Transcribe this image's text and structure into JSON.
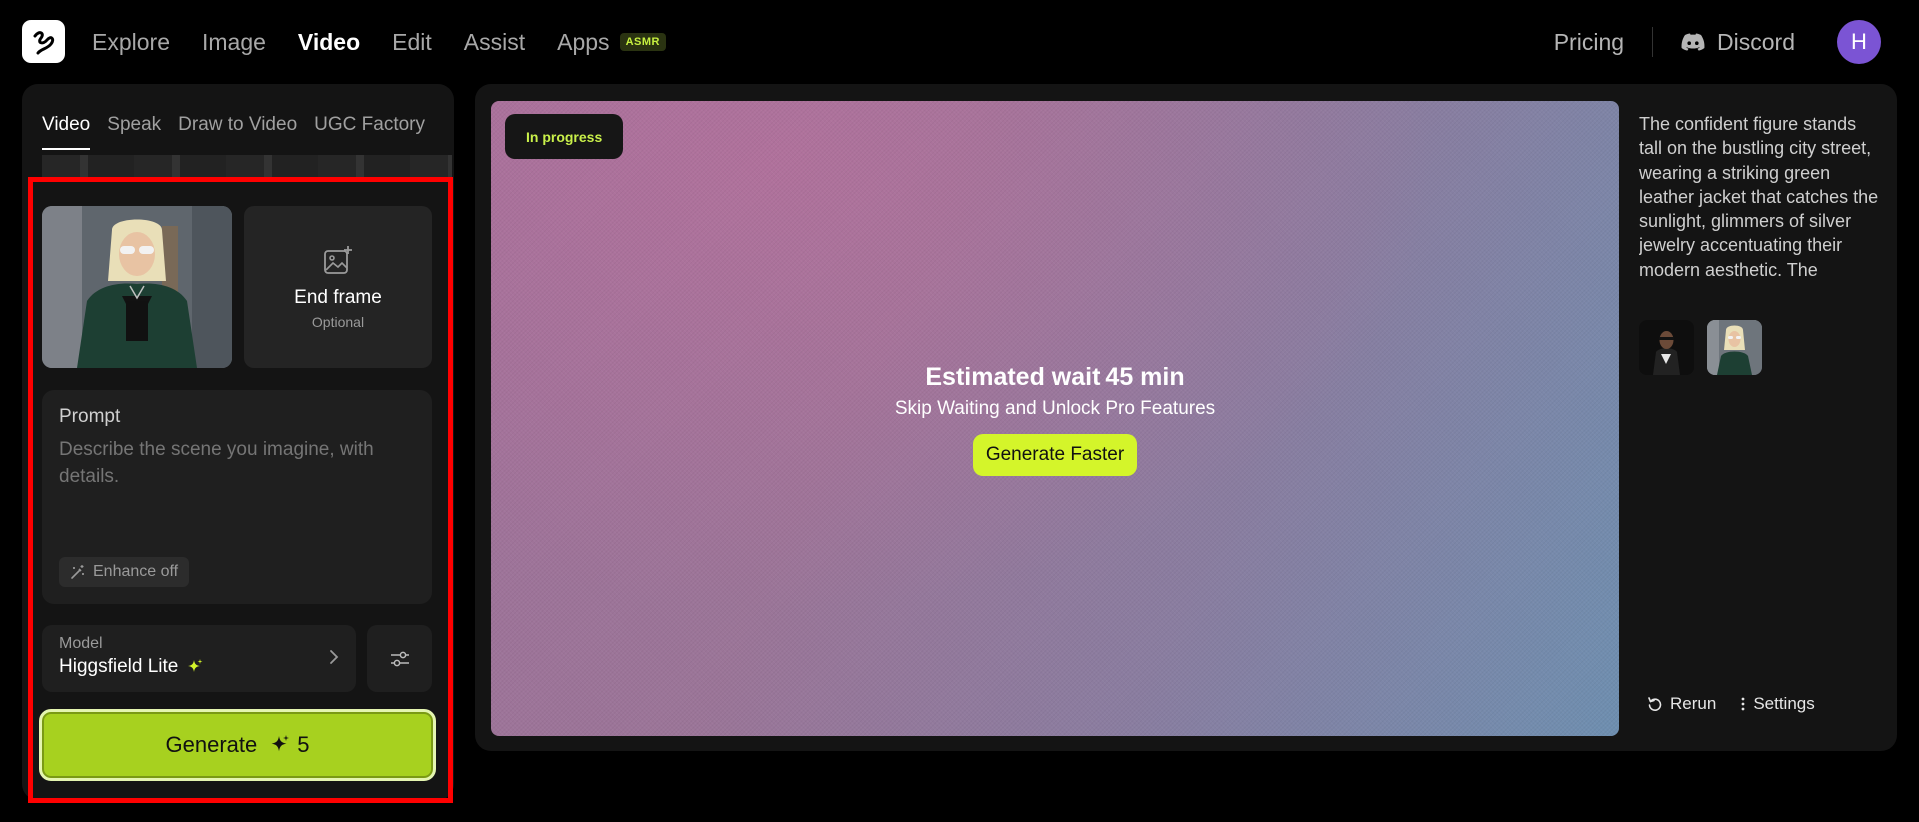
{
  "nav": {
    "items": [
      {
        "label": "Explore",
        "active": false
      },
      {
        "label": "Image",
        "active": false
      },
      {
        "label": "Video",
        "active": true
      },
      {
        "label": "Edit",
        "active": false
      },
      {
        "label": "Assist",
        "active": false
      },
      {
        "label": "Apps",
        "active": false
      }
    ],
    "apps_badge": "ASMR",
    "pricing": "Pricing",
    "discord": "Discord",
    "avatar_initial": "H"
  },
  "left_panel": {
    "tabs": [
      {
        "label": "Video",
        "active": true
      },
      {
        "label": "Speak",
        "active": false
      },
      {
        "label": "Draw to Video",
        "active": false
      },
      {
        "label": "UGC Factory",
        "active": false
      }
    ],
    "end_frame": {
      "title": "End frame",
      "subtitle": "Optional"
    },
    "prompt": {
      "label": "Prompt",
      "placeholder": "Describe the scene you imagine, with details.",
      "enhance_label": "Enhance off"
    },
    "model": {
      "label": "Model",
      "name": "Higgsfield Lite"
    },
    "generate": {
      "label": "Generate",
      "cost": "5"
    }
  },
  "main": {
    "status": "In progress",
    "wait_title": "Estimated wait 45 min",
    "wait_subtitle": "Skip Waiting and Unlock Pro Features",
    "faster_button": "Generate Faster",
    "description": "The confident figure stands tall on the bustling city street, wearing a striking green leather jacket that catches the sunlight, glimmers of silver jewelry accentuating their modern aesthetic. The",
    "actions": {
      "rerun": "Rerun",
      "settings": "Settings"
    }
  },
  "colors": {
    "accent": "#a7d11f",
    "accent_bright": "#d4f52a",
    "highlight": "#ff0000",
    "avatar": "#7b54d4",
    "status_text": "#c9f04a"
  },
  "icons": [
    "logo-icon",
    "discord-icon",
    "image-plus-icon",
    "magic-wand-icon",
    "sparkle-icon",
    "chevron-right-icon",
    "sliders-icon",
    "rerun-icon",
    "more-vertical-icon"
  ]
}
